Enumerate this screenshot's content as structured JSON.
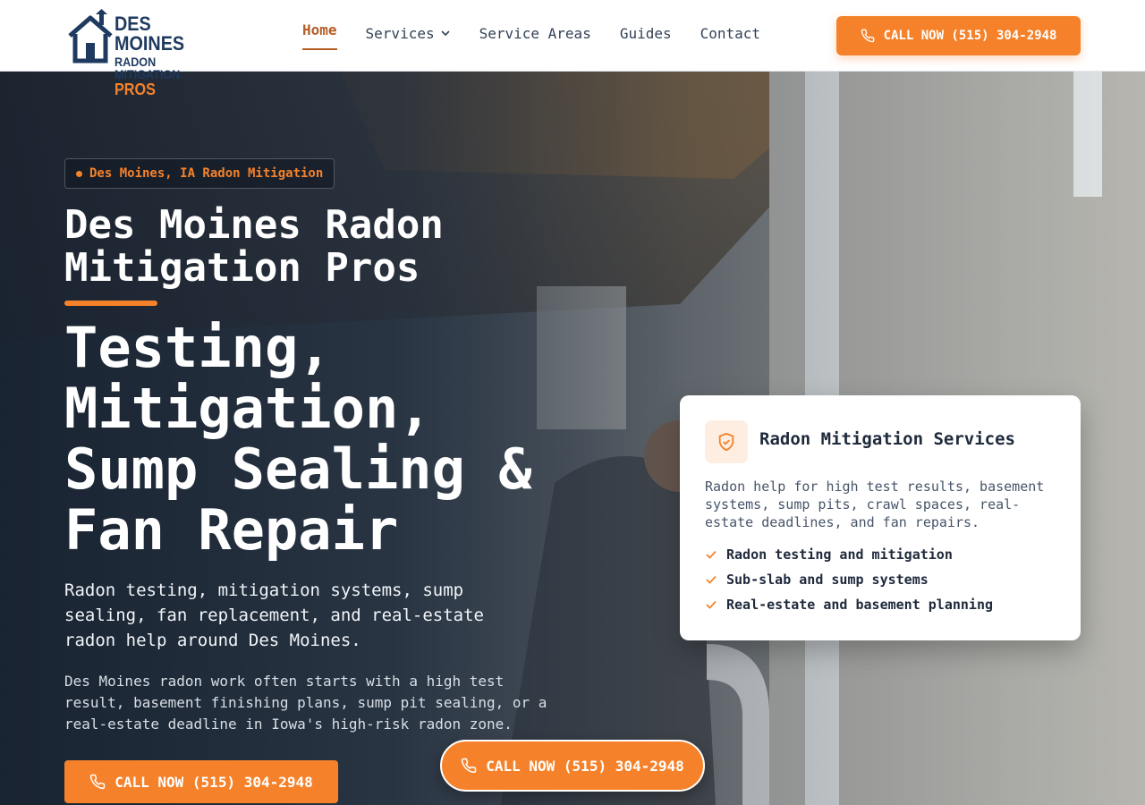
{
  "header": {
    "logo": {
      "line1": "DES MOINES",
      "line2": "RADON MITIGATION",
      "line3": "PROS"
    },
    "nav": [
      {
        "label": "Home",
        "active": true
      },
      {
        "label": "Services",
        "has_dropdown": true
      },
      {
        "label": "Service Areas"
      },
      {
        "label": "Guides"
      },
      {
        "label": "Contact"
      }
    ],
    "cta_label": "CALL NOW (515) 304-2948"
  },
  "hero": {
    "badge": "Des Moines, IA Radon Mitigation",
    "brand_title": "Des Moines Radon Mitigation Pros",
    "headline": "Testing, Mitigation, Sump Sealing & Fan Repair",
    "lead": "Radon testing, mitigation systems, sump sealing, fan replacement, and real-estate radon help around Des Moines.",
    "description": "Des Moines radon work often starts with a high test result, basement finishing plans, sump pit sealing, or a real-estate deadline in Iowa's high-risk radon zone.",
    "cta_primary": "CALL NOW (515) 304-2948",
    "cta_floating": "CALL NOW (515) 304-2948"
  },
  "card": {
    "icon": "shield-check-icon",
    "title": "Radon Mitigation Services",
    "description": "Radon help for high test results, basement systems, sump pits, crawl spaces, real-estate deadlines, and fan repairs.",
    "items": [
      "Radon testing and mitigation",
      "Sub-slab and sump systems",
      "Real-estate and basement planning"
    ]
  },
  "colors": {
    "accent": "#f5822a",
    "navy": "#1e3a5f",
    "active_nav": "#b45e26"
  }
}
